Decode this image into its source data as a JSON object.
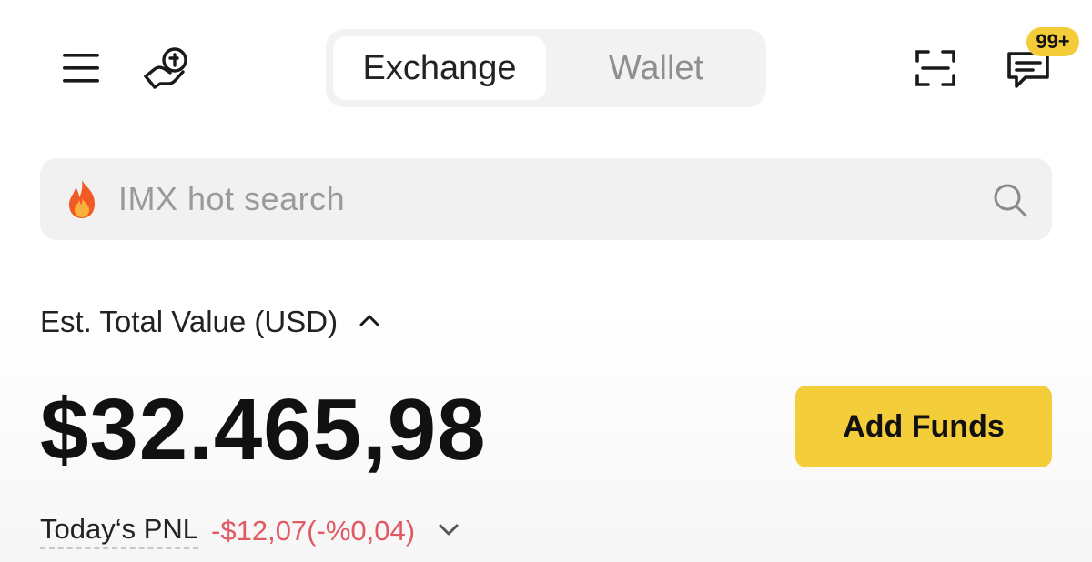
{
  "header": {
    "tabs": [
      {
        "label": "Exchange",
        "active": true
      },
      {
        "label": "Wallet",
        "active": false
      }
    ],
    "icons": {
      "menu": "hamburger-menu-icon",
      "referral": "referral-hand-coin-icon",
      "scan": "scan-icon",
      "messages": "messages-icon"
    },
    "notification_badge": "99+"
  },
  "search": {
    "placeholder": "IMX hot search",
    "leading_icon": "fire-icon",
    "trailing_icon": "search-icon"
  },
  "balance": {
    "label": "Est. Total Value (USD)",
    "value": "$32.465,98",
    "toggle_icon": "chevron-up-icon"
  },
  "actions": {
    "add_funds_label": "Add Funds"
  },
  "pnl": {
    "label": "Today‘s PNL",
    "value": "-$12,07(-%0,04)",
    "expand_icon": "chevron-down-icon"
  },
  "colors": {
    "accent": "#f4cd3b",
    "negative": "#e05a63",
    "inactive_text": "#8f8f8f"
  }
}
